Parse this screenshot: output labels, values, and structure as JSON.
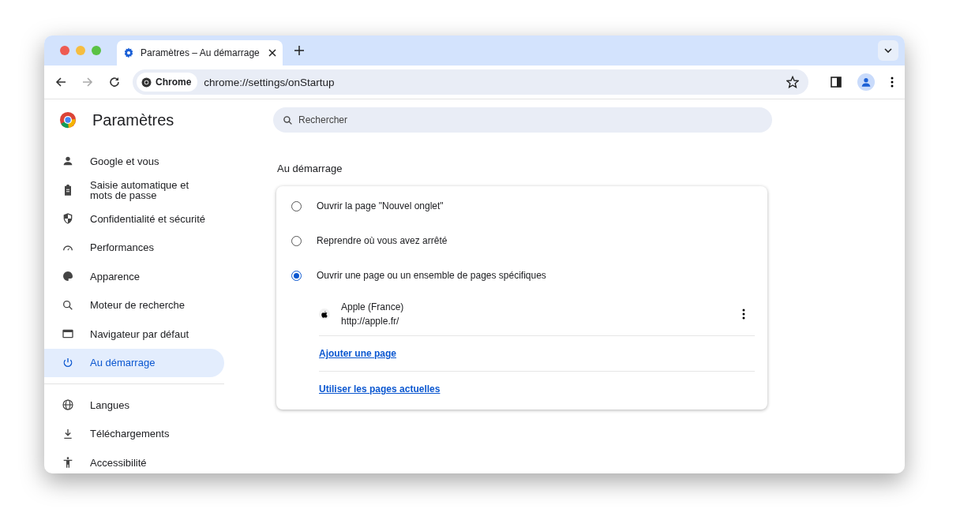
{
  "tab": {
    "title": "Paramètres – Au démarrage",
    "selected": true
  },
  "omnibox": {
    "chip": "Chrome",
    "url": "chrome://settings/onStartup"
  },
  "sidebar": {
    "title": "Paramètres",
    "items": [
      {
        "label": "Google et vous",
        "selected": false
      },
      {
        "label": "Saisie automatique et mots de passe",
        "selected": false
      },
      {
        "label": "Confidentialité et sécurité",
        "selected": false
      },
      {
        "label": "Performances",
        "selected": false
      },
      {
        "label": "Apparence",
        "selected": false
      },
      {
        "label": "Moteur de recherche",
        "selected": false
      },
      {
        "label": "Navigateur par défaut",
        "selected": false
      },
      {
        "label": "Au démarrage",
        "selected": true
      },
      {
        "label": "Langues",
        "selected": false
      },
      {
        "label": "Téléchargements",
        "selected": false
      },
      {
        "label": "Accessibilité",
        "selected": false
      }
    ]
  },
  "search": {
    "placeholder": "Rechercher"
  },
  "section": {
    "title": "Au démarrage",
    "options": [
      {
        "label": "Ouvrir la page \"Nouvel onglet\"",
        "selected": false
      },
      {
        "label": "Reprendre où vous avez arrêté",
        "selected": false
      },
      {
        "label": "Ouvrir une page ou un ensemble de pages spécifiques",
        "selected": true
      }
    ],
    "pages": [
      {
        "name": "Apple (France)",
        "url": "http://apple.fr/"
      }
    ],
    "links": [
      "Ajouter une page",
      "Utiliser les pages actuelles"
    ]
  }
}
